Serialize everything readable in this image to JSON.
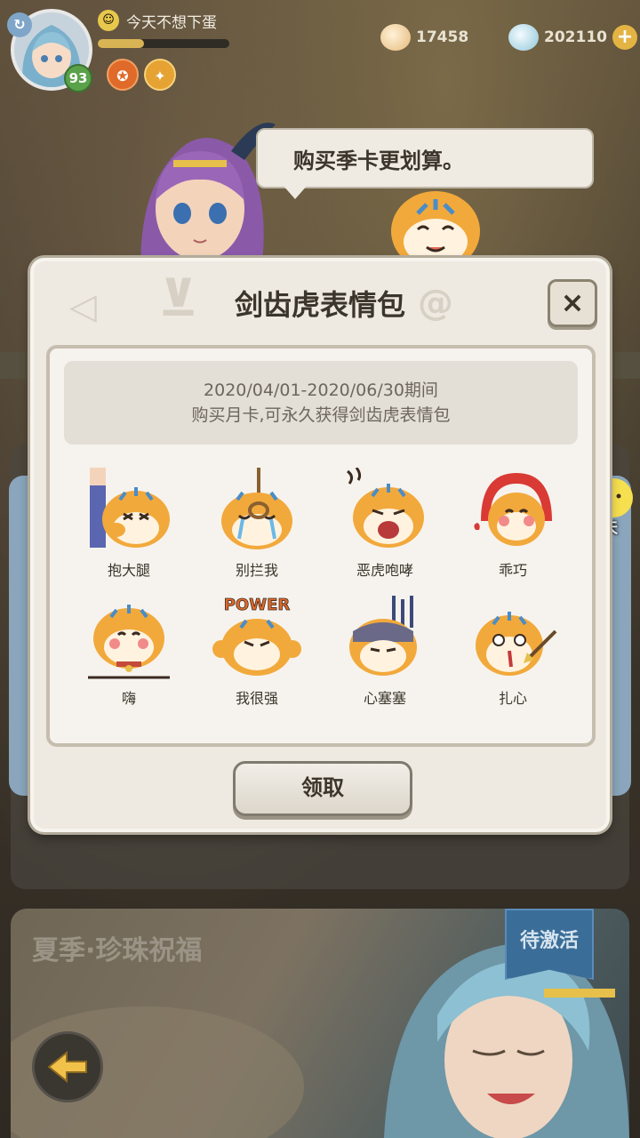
{
  "player": {
    "name": "今天不想下蛋",
    "level": "93",
    "exp_fraction": 0.35
  },
  "currencies": {
    "shells": "17458",
    "pearls": "202110",
    "add_label": "+"
  },
  "npc_speech": "购买季卡更划算。",
  "dialog": {
    "title": "剑齿虎表情包",
    "close_label": "×",
    "notice_line1": "2020/04/01-2020/06/30期间",
    "notice_line2": "购买月卡,可永久获得剑齿虎表情包",
    "stickers": [
      {
        "label": "抱大腿",
        "icon": "tiger-hug-leg-icon"
      },
      {
        "label": "别拦我",
        "icon": "tiger-rope-icon"
      },
      {
        "label": "恶虎咆哮",
        "icon": "tiger-roar-icon"
      },
      {
        "label": "乖巧",
        "icon": "tiger-hood-icon"
      },
      {
        "label": "嗨",
        "icon": "tiger-wave-icon"
      },
      {
        "label": "我很强",
        "icon": "tiger-power-icon",
        "art_text": "POWER"
      },
      {
        "label": "心塞塞",
        "icon": "tiger-gloom-icon"
      },
      {
        "label": "扎心",
        "icon": "tiger-arrow-heart-icon"
      }
    ],
    "claim_label": "领取"
  },
  "chat": {
    "label": "聊天"
  },
  "bottom_card": {
    "title": "夏季·珍珠祝福",
    "status": "待激活"
  },
  "colors": {
    "dialog_bg": "#eee9e1",
    "tiger_orange": "#f2a93b",
    "tiger_stripe": "#4a8cc7",
    "status_blue": "#3a6d98"
  }
}
